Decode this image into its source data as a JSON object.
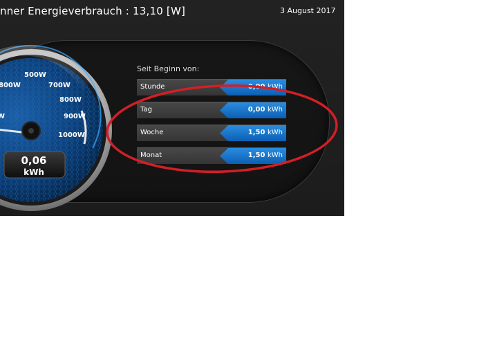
{
  "header": {
    "title": "nner Energieverbrauch : 13,10 [W]",
    "date": "3 August 2017"
  },
  "gauge": {
    "tick_labels": [
      "800W",
      "500W",
      "700W",
      "800W",
      "900W",
      "1000W",
      "W"
    ],
    "readout_value": "0,06",
    "readout_unit": "kWh",
    "colors": {
      "face": "#0b3f7a",
      "accent": "#1e90ff",
      "bezel": "#c8c8c8"
    }
  },
  "summary": {
    "since_label": "Seit Beginn von:",
    "rows": [
      {
        "label": "Stunde",
        "value": "0,00",
        "unit": "kWh"
      },
      {
        "label": "Tag",
        "value": "0,00",
        "unit": "kWh"
      },
      {
        "label": "Woche",
        "value": "1,50",
        "unit": "kWh"
      },
      {
        "label": "Monat",
        "value": "1,50",
        "unit": "kWh"
      }
    ]
  },
  "annotation": {
    "color": "#d21f26",
    "shape": "ellipse"
  }
}
